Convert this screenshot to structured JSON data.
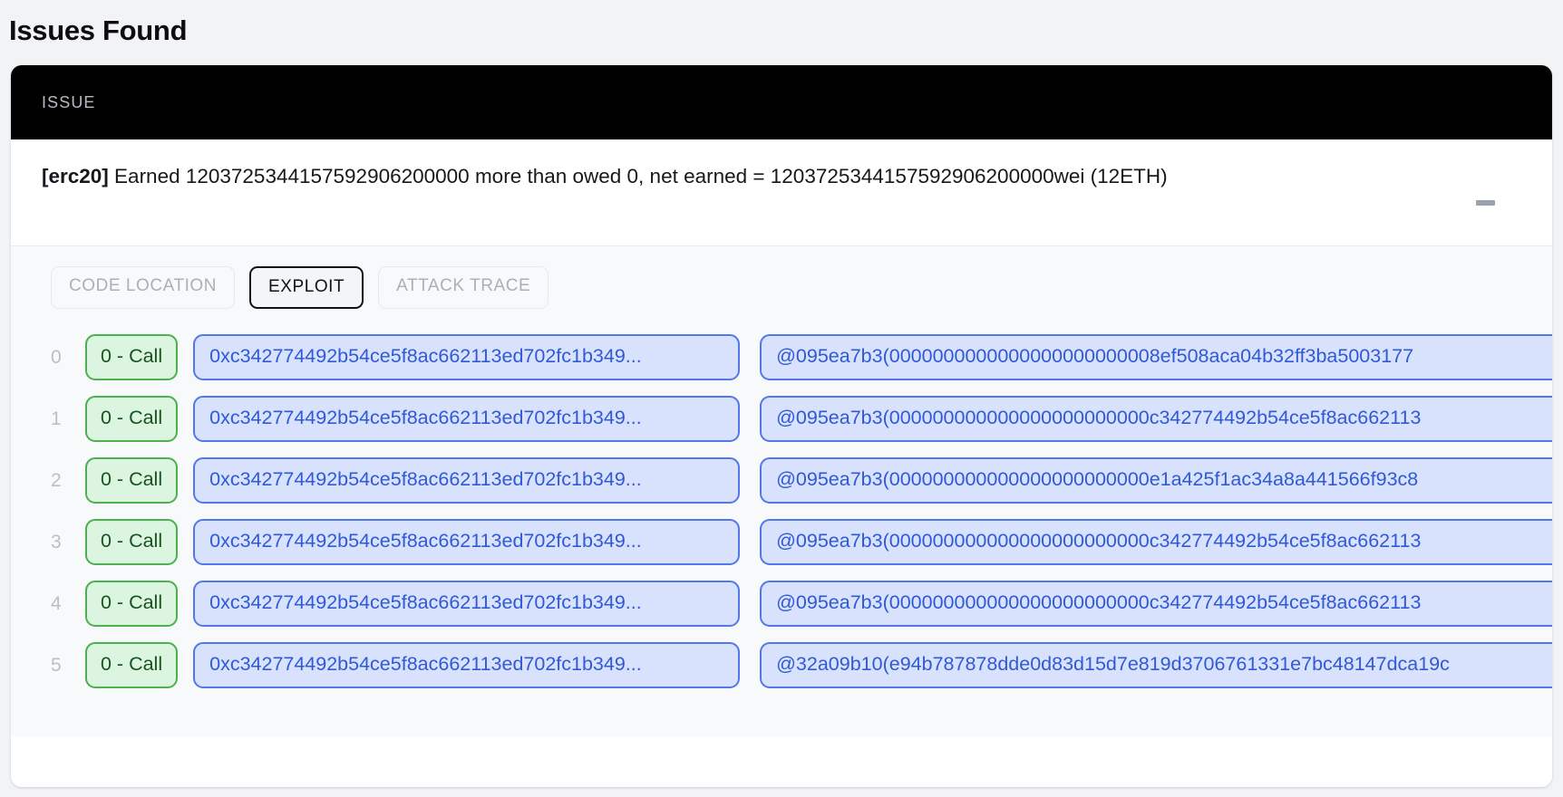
{
  "page": {
    "title": "Issues Found"
  },
  "card": {
    "header": {
      "column_label": "ISSUE"
    },
    "issue": {
      "tag": "[erc20]",
      "description": " Earned 1203725344157592906200000 more than owed 0, net earned = 1203725344157592906200000wei (12ETH)",
      "collapse_icon": "minus-icon"
    },
    "tabs": [
      {
        "label": "CODE LOCATION",
        "active": false
      },
      {
        "label": "EXPLOIT",
        "active": true
      },
      {
        "label": "ATTACK TRACE",
        "active": false
      }
    ],
    "trace_rows": [
      {
        "index": "0",
        "call": "0 - Call",
        "address": "0xc342774492b54ce5f8ac662113ed702fc1b349...",
        "calldata": "@095ea7b3(0000000000000000000000008ef508aca04b32ff3ba5003177"
      },
      {
        "index": "1",
        "call": "0 - Call",
        "address": "0xc342774492b54ce5f8ac662113ed702fc1b349...",
        "calldata": "@095ea7b3(000000000000000000000000c342774492b54ce5f8ac662113"
      },
      {
        "index": "2",
        "call": "0 - Call",
        "address": "0xc342774492b54ce5f8ac662113ed702fc1b349...",
        "calldata": "@095ea7b3(000000000000000000000000e1a425f1ac34a8a441566f93c8"
      },
      {
        "index": "3",
        "call": "0 - Call",
        "address": "0xc342774492b54ce5f8ac662113ed702fc1b349...",
        "calldata": "@095ea7b3(000000000000000000000000c342774492b54ce5f8ac662113"
      },
      {
        "index": "4",
        "call": "0 - Call",
        "address": "0xc342774492b54ce5f8ac662113ed702fc1b349...",
        "calldata": "@095ea7b3(000000000000000000000000c342774492b54ce5f8ac662113"
      },
      {
        "index": "5",
        "call": "0 - Call",
        "address": "0xc342774492b54ce5f8ac662113ed702fc1b349...",
        "calldata": "@32a09b10(e94b787878dde0d83d15d7e819d3706761331e7bc48147dca19c"
      }
    ]
  },
  "colors": {
    "page_background": "#f1f3f5",
    "header_background": "#000000",
    "call_chip_border": "#4caf50",
    "call_chip_background": "#dcf5e0",
    "data_chip_border": "#5377e8",
    "data_chip_background": "#d9e2fd",
    "data_chip_text": "#3059d8",
    "active_tab_border": "#111216",
    "inactive_tab_text": "#a9b0ba"
  }
}
